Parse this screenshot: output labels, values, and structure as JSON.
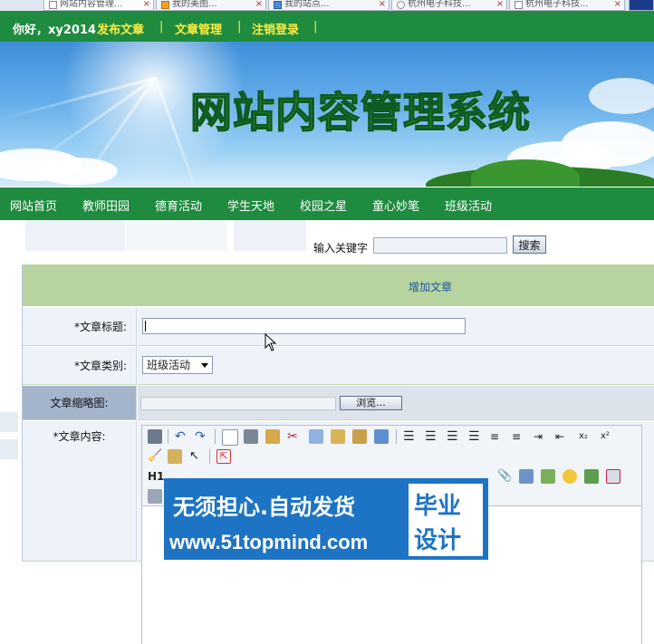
{
  "browser_tabs": [
    {
      "label": "网站内容管理..."
    },
    {
      "label": "我的美图..."
    },
    {
      "label": "我的站点..."
    },
    {
      "label": "杭州电子科技..."
    },
    {
      "label": "杭州电子科技..."
    }
  ],
  "topbar": {
    "greeting": "你好，xy2014",
    "publish": "发布文章",
    "sep1": "|",
    "manage": "文章管理",
    "sep2": "|",
    "logout": "注销登录",
    "sep3": "|"
  },
  "banner": {
    "title": "网站内容管理系统"
  },
  "nav": {
    "items": [
      "网站首页",
      "教师田园",
      "德育活动",
      "学生天地",
      "校园之星",
      "童心妙笔",
      "班级活动"
    ]
  },
  "search": {
    "label": "输入关键字",
    "value": "",
    "button": "搜索"
  },
  "form": {
    "header": "增加文章",
    "title_label": "*文章标题:",
    "title_value": "",
    "category_label": "*文章类别:",
    "category_value": "班级活动",
    "thumb_label": "文章缩略图:",
    "browse_label": "浏览...",
    "content_label": "*文章内容:",
    "heading_button": "H1"
  },
  "watermark": {
    "line1": "无须担心.自动发货",
    "line2": "www.51topmind.com",
    "right1": "毕业",
    "right2": "设计"
  },
  "colors": {
    "nav_green": "#1f8b3f",
    "header_green": "#b6d3a0",
    "link_yellow": "#ffee44",
    "watermark_blue": "#1d74c4"
  }
}
